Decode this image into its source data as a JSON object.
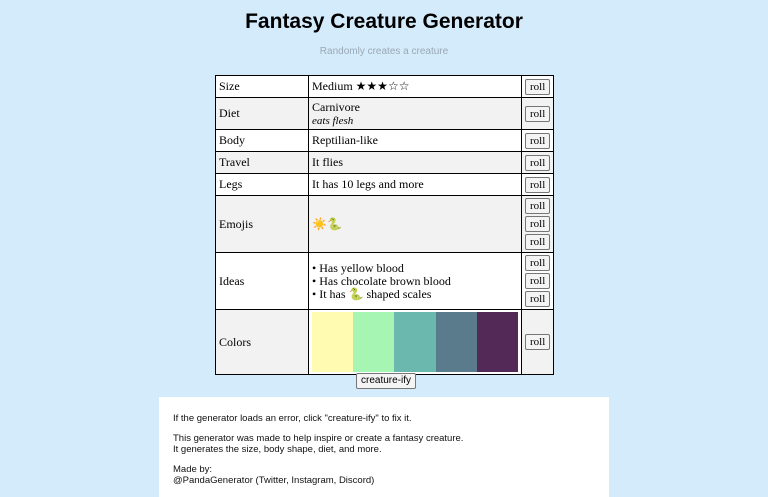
{
  "page": {
    "title": "Fantasy Creature Generator",
    "subtitle": "Randomly creates a creature"
  },
  "rows": {
    "size": {
      "label": "Size",
      "value": "Medium ★★★☆☆"
    },
    "diet": {
      "label": "Diet",
      "value": "Carnivore",
      "sub": "eats flesh"
    },
    "body": {
      "label": "Body",
      "value": "Reptilian-like"
    },
    "travel": {
      "label": "Travel",
      "value": "It flies"
    },
    "legs": {
      "label": "Legs",
      "value": "It has 10 legs and more"
    },
    "emojis": {
      "label": "Emojis",
      "value": "☀️🐍"
    },
    "ideas": {
      "label": "Ideas",
      "items": [
        "• Has yellow blood",
        "• Has chocolate brown blood",
        "• It has 🐍 shaped scales"
      ]
    },
    "colors": {
      "label": "Colors",
      "swatches": [
        "#fffcb2",
        "#a7f5b2",
        "#6bb9ae",
        "#5a7b8b",
        "#532957"
      ]
    }
  },
  "buttons": {
    "roll": "roll",
    "creatify": "creature-ify"
  },
  "info": {
    "line1": "If the generator loads an error, click \"creature-ify\" to fix it.",
    "line2": "This generator was made to help inspire or create a fantasy creature.",
    "line3": "It generates the size, body shape, diet, and more.",
    "line4": "Made by:",
    "line5": "@PandaGenerator (Twitter, Instagram, Discord)"
  }
}
